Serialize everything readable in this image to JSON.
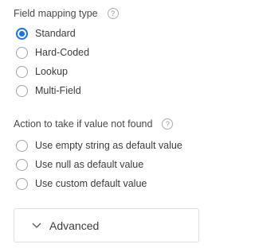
{
  "mapping": {
    "label": "Field mapping type",
    "options": [
      {
        "label": "Standard",
        "checked": true
      },
      {
        "label": "Hard-Coded",
        "checked": false
      },
      {
        "label": "Lookup",
        "checked": false
      },
      {
        "label": "Multi-Field",
        "checked": false
      }
    ]
  },
  "not_found": {
    "label": "Action to take if value not found",
    "options": [
      {
        "label": "Use empty string as default value",
        "checked": false
      },
      {
        "label": "Use null as default value",
        "checked": false
      },
      {
        "label": "Use custom default value",
        "checked": false
      }
    ]
  },
  "advanced": {
    "label": "Advanced"
  },
  "icons": {
    "help": "question-circle-icon",
    "chevron": "chevron-down-icon"
  },
  "colors": {
    "accent": "#1a73e8",
    "border": "#dde0e4",
    "text": "#3c3c3c"
  }
}
